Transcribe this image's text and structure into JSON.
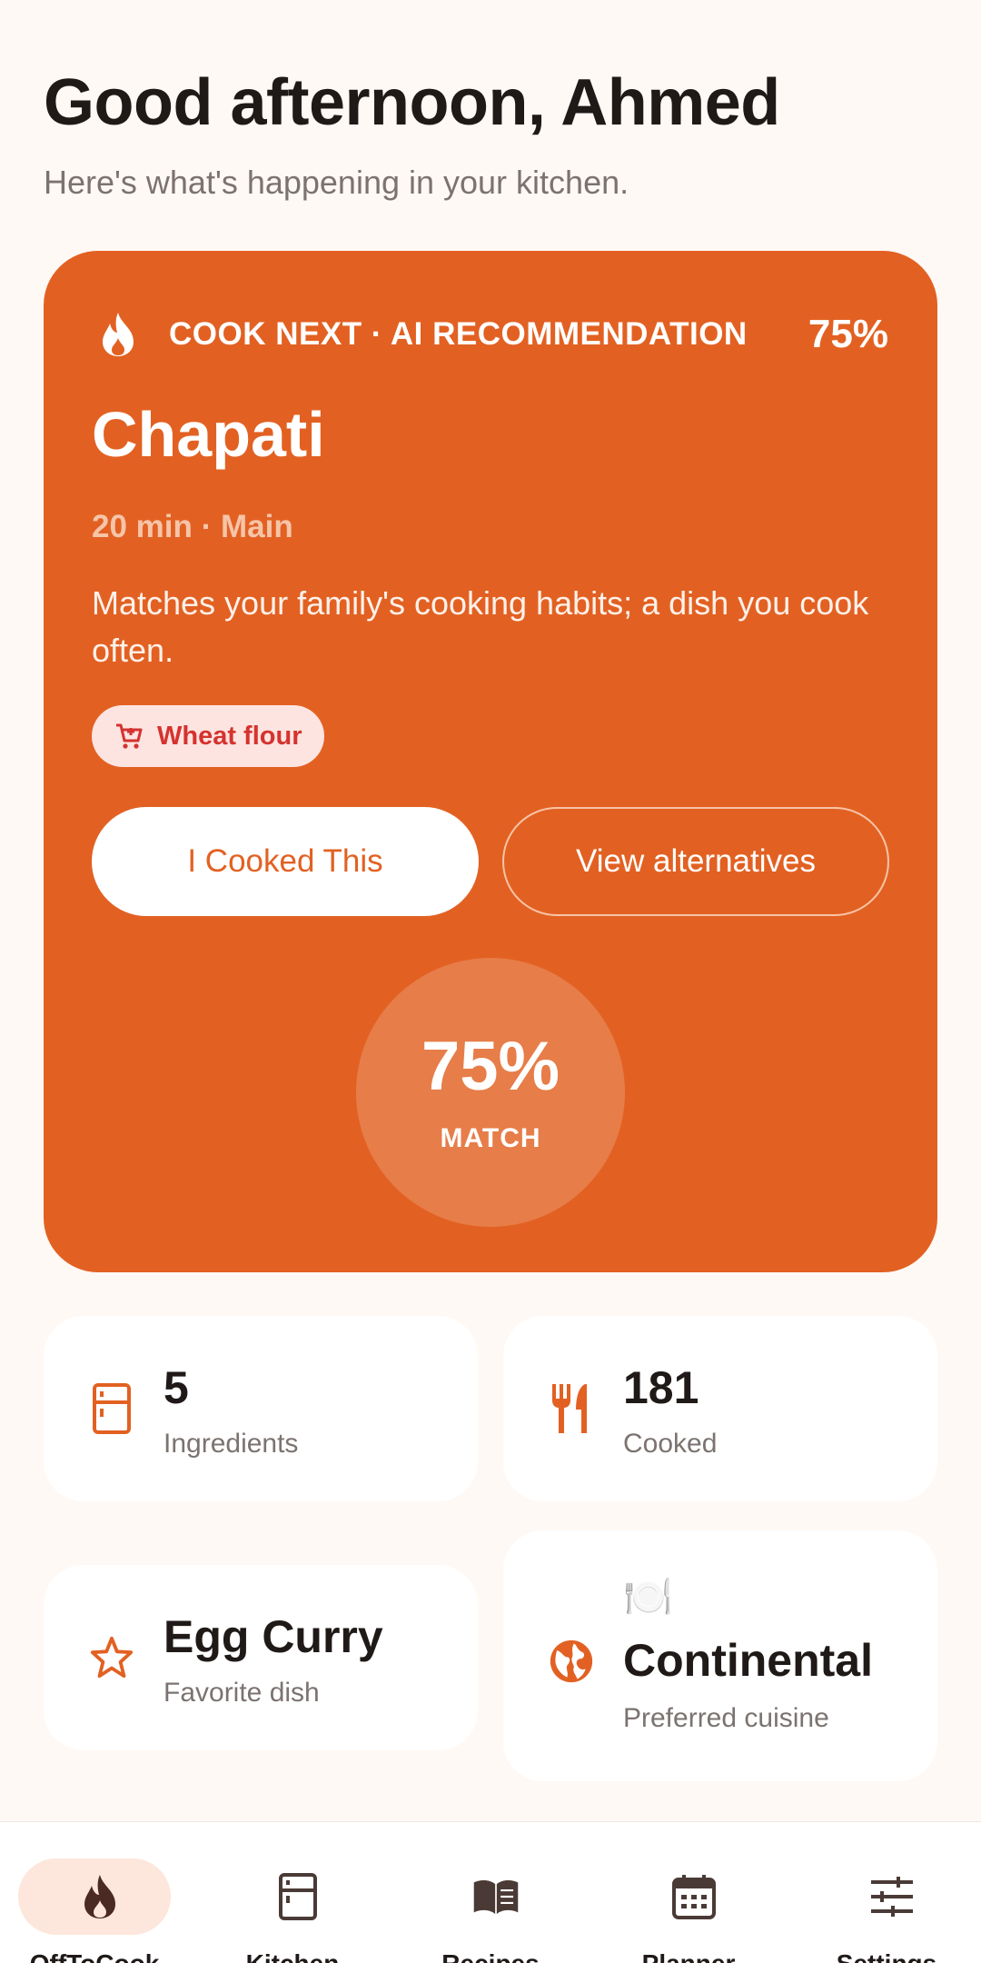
{
  "header": {
    "greeting": "Good afternoon, Ahmed",
    "subtitle": "Here's what's happening in your kitchen."
  },
  "recommendation": {
    "label": "COOK NEXT · AI RECOMMENDATION",
    "percent": "75%",
    "dish": "Chapati",
    "meta": "20 min · Main",
    "reason": "Matches your family's cooking habits; a dish you cook often.",
    "missing_ingredient": "Wheat flour",
    "primary_button": "I Cooked This",
    "secondary_button": "View alternatives",
    "match_value": "75%",
    "match_label": "MATCH",
    "match_fraction": 0.75
  },
  "stats": {
    "ingredients": {
      "value": "5",
      "caption": "Ingredients",
      "icon": "fridge-icon"
    },
    "cooked": {
      "value": "181",
      "caption": "Cooked",
      "icon": "utensils-icon"
    },
    "favorite": {
      "value": "Egg Curry",
      "caption": "Favorite dish",
      "icon": "star-icon"
    },
    "cuisine": {
      "emoji": "🍽️",
      "value": "Continental",
      "caption": "Preferred cuisine",
      "icon": "globe-icon"
    }
  },
  "nav": {
    "items": [
      {
        "label": "OffToCook",
        "icon": "flame-icon",
        "active": true
      },
      {
        "label": "Kitchen",
        "icon": "fridge-icon",
        "active": false
      },
      {
        "label": "Recipes",
        "icon": "book-icon",
        "active": false
      },
      {
        "label": "Planner",
        "icon": "calendar-icon",
        "active": false
      },
      {
        "label": "Settings",
        "icon": "sliders-icon",
        "active": false
      }
    ]
  },
  "colors": {
    "accent": "#E26122",
    "background": "#FFF9F6",
    "chip_text": "#D5332F",
    "chip_bg": "#FDE4E1"
  }
}
